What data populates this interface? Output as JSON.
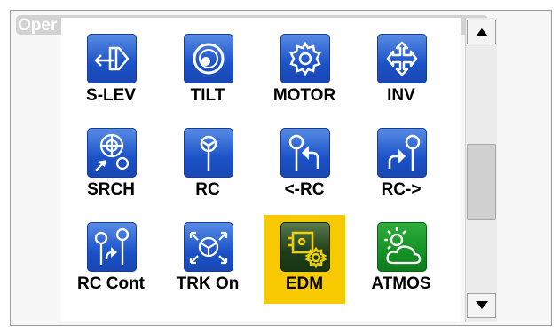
{
  "background": {
    "title": "Oper"
  },
  "tiles": [
    {
      "label": "S-LEV",
      "icon": "s-lev-icon",
      "selected": false
    },
    {
      "label": "TILT",
      "icon": "tilt-icon",
      "selected": false
    },
    {
      "label": "MOTOR",
      "icon": "motor-gear-icon",
      "selected": false
    },
    {
      "label": "INV",
      "icon": "invert-icon",
      "selected": false
    },
    {
      "label": "SRCH",
      "icon": "search-prism-icon",
      "selected": false
    },
    {
      "label": "RC",
      "icon": "remote-prism-icon",
      "selected": false
    },
    {
      "label": "<-RC",
      "icon": "rc-left-icon",
      "selected": false
    },
    {
      "label": "RC->",
      "icon": "rc-right-icon",
      "selected": false
    },
    {
      "label": "RC Cont",
      "icon": "rc-continue-icon",
      "selected": false
    },
    {
      "label": "TRK On",
      "icon": "tracking-icon",
      "selected": false
    },
    {
      "label": "EDM",
      "icon": "edm-settings-icon",
      "selected": true
    },
    {
      "label": "ATMOS",
      "icon": "weather-icon",
      "selected": false
    }
  ],
  "colors": {
    "icon_blue": "#2a5fd3",
    "icon_dark": "#23411c",
    "icon_green": "#14912a",
    "selection": "#f7c900"
  }
}
